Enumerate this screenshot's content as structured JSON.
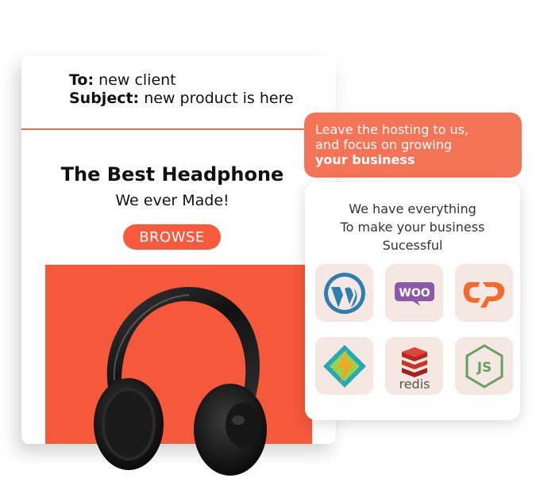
{
  "email": {
    "to_label": "To:",
    "to_value": "new client",
    "subject_label": "Subject:",
    "subject_value": "new product is here",
    "title": "The Best Headphone",
    "subtitle": "We ever Made!",
    "browse_label": "BROWSE",
    "hero_image": "headphones-image"
  },
  "callout": {
    "line1": "Leave the hosting to us,",
    "line2": "and focus on growing",
    "line3": "your business"
  },
  "tools": {
    "line1": "We have everything",
    "line2": "To make your business",
    "line3": "Sucessful",
    "icons": [
      "wordpress-icon",
      "woocommerce-icon",
      "cpanel-icon",
      "litespeed-icon",
      "redis-icon",
      "nodejs-icon"
    ],
    "woo_text": "WOO",
    "redis_text": "redis",
    "js_text": "JS"
  },
  "colors": {
    "accent": "#f85a3e",
    "callout": "#f47457",
    "tile": "#f5e8e3"
  }
}
